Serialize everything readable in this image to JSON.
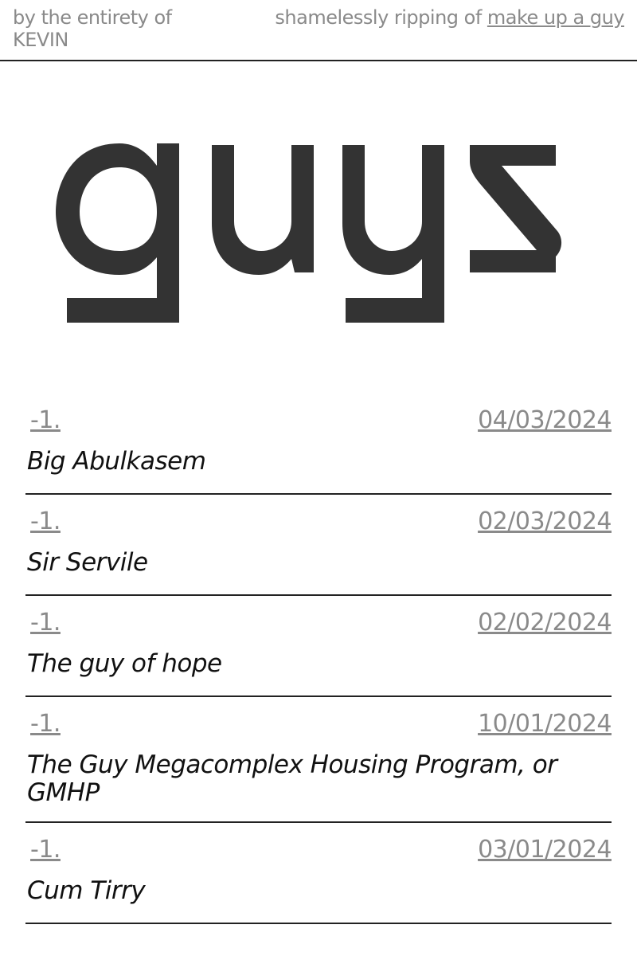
{
  "header": {
    "left_text": "by the entirety of KEVIN",
    "right_prefix": "shamelessly ripping of ",
    "right_link": "make up a guy"
  },
  "logo": {
    "text": "guys",
    "color": "#333333"
  },
  "entries": [
    {
      "score": "-1.",
      "date": "04/03/2024",
      "title": "Big Abulkasem"
    },
    {
      "score": "-1.",
      "date": "02/03/2024",
      "title": "Sir Servile"
    },
    {
      "score": "-1.",
      "date": "02/02/2024",
      "title": "The guy of hope"
    },
    {
      "score": "-1.",
      "date": "10/01/2024",
      "title": "The Guy Megacomplex Housing Program, or GMHP"
    },
    {
      "score": "-1.",
      "date": "03/01/2024",
      "title": "Cum Tirry"
    }
  ],
  "colors": {
    "muted_text": "#8a8a8a",
    "rule": "#222222",
    "title_text": "#111111"
  }
}
